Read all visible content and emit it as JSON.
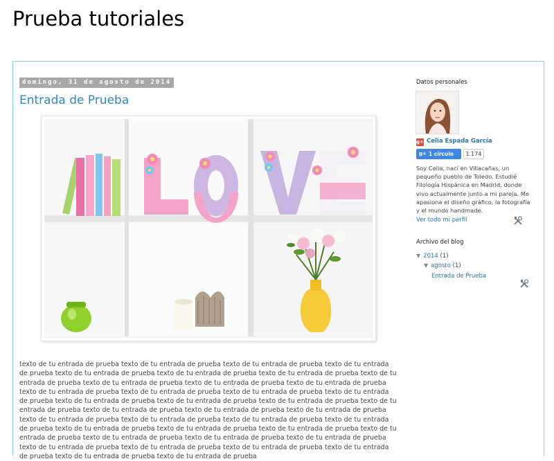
{
  "header": {
    "title": "Prueba tutoriales"
  },
  "post": {
    "date": "domingo, 31 de agosto de 2014",
    "title": "Entrada de Prueba",
    "body": "texto de tu entrada de prueba texto de tu entrada de prueba texto de tu entrada de prueba texto de tu entrada de prueba texto de tu entrada de prueba texto de tu entrada de prueba texto de tu entrada de prueba texto de tu entrada de prueba texto de tu entrada de prueba texto de tu entrada de prueba texto de tu entrada de prueba texto de tu entrada de prueba texto de tu entrada de prueba texto de tu entrada de prueba texto de tu entrada de prueba texto de tu entrada de prueba texto de tu entrada de prueba texto de tu entrada de prueba texto de tu entrada de prueba texto de tu entrada de prueba texto de tu entrada de prueba texto de tu entrada de prueba texto de tu entrada de prueba texto de tu entrada de prueba texto de tu entrada de prueba texto de tu entrada de prueba texto de tu entrada de prueba texto de tu entrada de prueba texto de tu entrada de prueba texto de tu entrada de prueba texto de tu entrada de prueba texto de tu entrada de prueba texto de tu entrada de prueba texto de tu entrada de prueba texto de tu entrada de prueba texto de tu entrada de prueba texto de tu entrada de prueba texto de tu entrada de prueba texto de tu entrada de prueba"
  },
  "sidebar": {
    "profile": {
      "heading": "Datos personales",
      "gplus_glyph": "g+",
      "name": "Celia Espada García",
      "follow_glyph": "g+",
      "follow_label": "1 círculo",
      "follow_count": "1.174",
      "about": "Soy Celia, nací en Villacañas, un pequeño pueblo de Toledo. Estudié Filología Hispánica en Madrid, donde vivo actualmente junto a mi pareja. Me apasiona el diseño gráfico, la fotografía y el mundo handmade.",
      "profile_link": "Ver todo mi perfil"
    },
    "archive": {
      "heading": "Archivo del blog",
      "year": {
        "label": "2014",
        "count": "(1)"
      },
      "month": {
        "label": "agosto",
        "count": "(1)"
      },
      "post": "Entrada de Prueba"
    }
  },
  "colors": {
    "accent_link": "#2a7aab",
    "border": "#7fd7e6",
    "date_bg": "#a8a8a8"
  },
  "icons": [
    "gplus-icon",
    "tools-icon",
    "triangle-down-icon"
  ]
}
